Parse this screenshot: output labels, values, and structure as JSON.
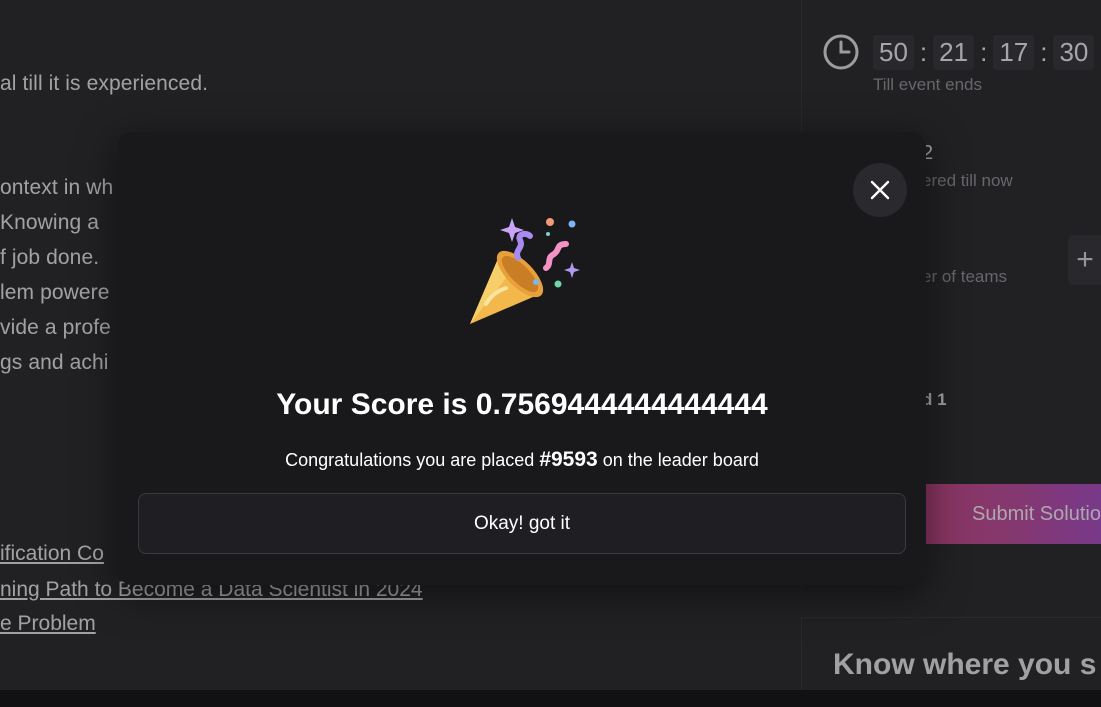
{
  "background": {
    "paragraph_lines": [
      "al till it is experienced.",
      "ontext in wh",
      " Knowing a",
      "f job done.",
      "lem powere",
      "vide a profe",
      "gs and achi"
    ],
    "links": [
      "ification Co",
      "ning Path to Become a Data Scientist in 2024",
      "e Problem"
    ]
  },
  "timer": {
    "days": "50",
    "hours": "21",
    "minutes": "17",
    "seconds": "30",
    "separator": ":",
    "label": "Till event ends"
  },
  "right_panel": {
    "count_partial": "2",
    "registered_partial": "ered till now",
    "teams_partial": "er of teams",
    "plus_label": "+",
    "round_partial": "d 1",
    "submit_label": "Submit Solutio",
    "know_title": "Know where you s"
  },
  "modal": {
    "score_title": "Your Score is 0.7569444444444444",
    "congrats_prefix": "Congratulations you are placed ",
    "rank": "#9593",
    "congrats_suffix": " on the leader board",
    "ok_label": "Okay! got it"
  },
  "colors": {
    "modal_bg": "#19181b",
    "page_bg": "#2f2e33",
    "submit_gradient_start": "#c2487a",
    "submit_gradient_end": "#a24fc8"
  },
  "icons": {
    "close": "close-icon",
    "party": "party-popper-icon",
    "clock": "clock-icon"
  }
}
